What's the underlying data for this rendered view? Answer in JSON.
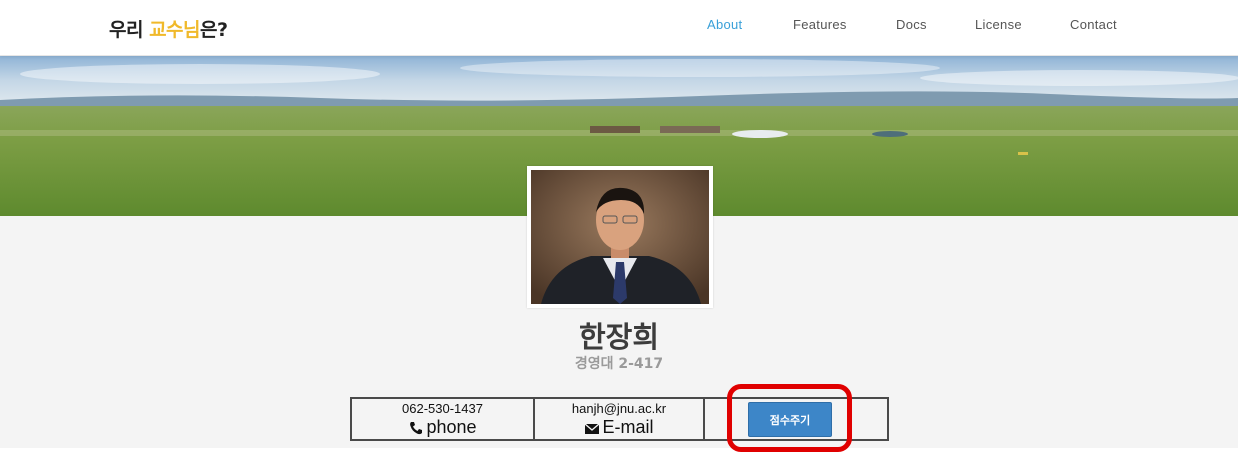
{
  "brand": {
    "part1": "우리 ",
    "highlight": "교수님",
    "part2": "은?",
    "highlight_color": "#f0b92a"
  },
  "nav": {
    "items": [
      {
        "label": "About",
        "active": true
      },
      {
        "label": "Features",
        "active": false
      },
      {
        "label": "Docs",
        "active": false
      },
      {
        "label": "License",
        "active": false
      },
      {
        "label": "Contact",
        "active": false
      }
    ],
    "active_color": "#3aa0d8"
  },
  "profile": {
    "name": "한장희",
    "office": "경영대 2-417"
  },
  "contact": {
    "phone_number": "062-530-1437",
    "phone_label": "phone",
    "phone_icon": "phone-icon",
    "email_address": "hanjh@jnu.ac.kr",
    "email_label": "E-mail",
    "email_icon": "envelope-icon"
  },
  "action": {
    "rate_button_label": "점수주기",
    "button_color": "#3d86c8",
    "highlight_color": "#e00000"
  }
}
